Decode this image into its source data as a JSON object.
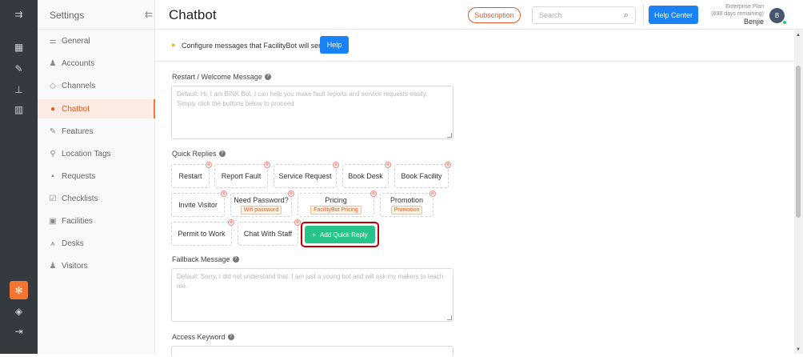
{
  "rail": {
    "icons": [
      "menu-icon",
      "dashboard-icon",
      "wrench-icon",
      "org-icon",
      "analytics-icon",
      "settings-icon",
      "box-icon",
      "logout-icon"
    ]
  },
  "sidebar": {
    "title": "Settings",
    "items": [
      {
        "label": "General",
        "icon": "sliders-icon"
      },
      {
        "label": "Accounts",
        "icon": "users-icon"
      },
      {
        "label": "Channels",
        "icon": "cube-icon"
      },
      {
        "label": "Chatbot",
        "icon": "chat-icon"
      },
      {
        "label": "Features",
        "icon": "wrench-icon"
      },
      {
        "label": "Location Tags",
        "icon": "pin-icon"
      },
      {
        "label": "Requests",
        "icon": "requests-icon"
      },
      {
        "label": "Checklists",
        "icon": "checklist-icon"
      },
      {
        "label": "Facilities",
        "icon": "calendar-icon"
      },
      {
        "label": "Desks",
        "icon": "desk-icon"
      },
      {
        "label": "Visitors",
        "icon": "visitors-icon"
      }
    ]
  },
  "header": {
    "title": "Chatbot",
    "subscription_label": "Subscription",
    "search_placeholder": "Search",
    "help_center_label": "Help Center",
    "plan_name": "Enterprise Plan",
    "plan_remaining": "(698 days remaining)",
    "user_name": "Benjie",
    "avatar_initial": "B"
  },
  "info": {
    "text": "Configure messages that FacilityBot will send.",
    "help_label": "Help"
  },
  "welcome": {
    "label": "Restart / Welcome Message",
    "placeholder": "Default: Hi, I am BINK Bot. I can help you make fault reports and service requests easily. Simply click the buttons below to proceed"
  },
  "quick_replies": {
    "label": "Quick Replies",
    "chips": [
      {
        "label": "Restart"
      },
      {
        "label": "Report Fault"
      },
      {
        "label": "Service Request"
      },
      {
        "label": "Book Desk"
      },
      {
        "label": "Book Facility"
      },
      {
        "label": "Invite Visitor"
      },
      {
        "label": "Need Password?",
        "tag": "Wifi password"
      },
      {
        "label": "Pricing",
        "tag": "FacilityBot Pricing"
      },
      {
        "label": "Promotion",
        "tag": "Promotion"
      },
      {
        "label": "Permit to Work"
      },
      {
        "label": "Chat With Staff"
      }
    ],
    "add_label": "Add Quick Reply",
    "remove_symbol": "⊗"
  },
  "fallback": {
    "label": "Fallback Message",
    "placeholder": "Default: Sorry, I did not understand that. I am just a young bot and will ask my makers to teach me."
  },
  "access_keyword": {
    "label": "Access Keyword"
  },
  "colors": {
    "brand_orange": "#f47432",
    "primary_blue": "#1a82f7",
    "add_green": "#27c48a",
    "highlight_red": "#c00000"
  }
}
